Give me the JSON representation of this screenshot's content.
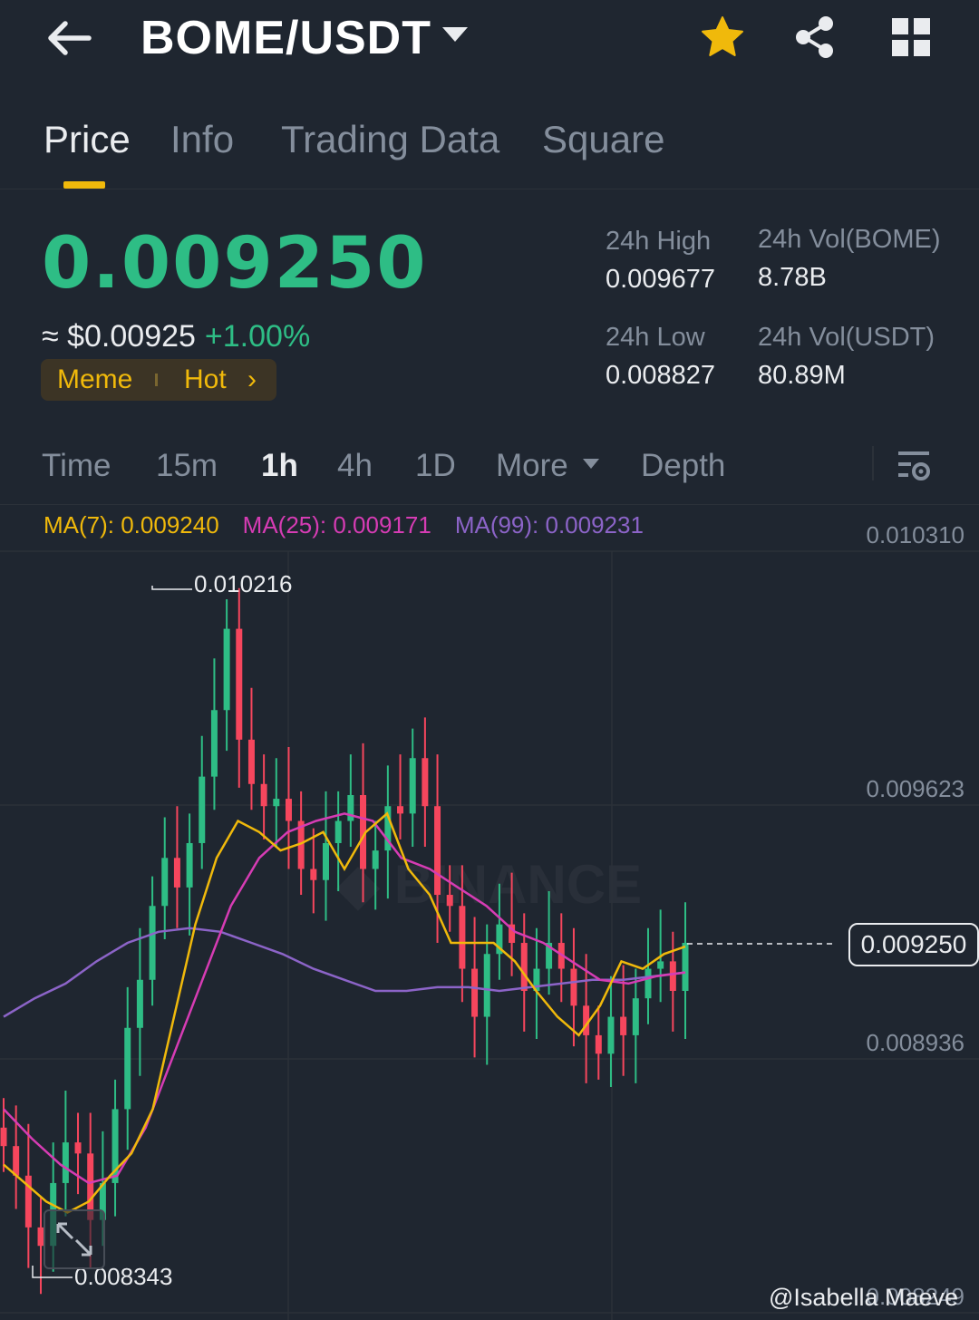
{
  "header": {
    "pair": "BOME/USDT",
    "icons": [
      "back-arrow-icon",
      "caret-down-icon",
      "star-icon",
      "share-icon",
      "grid-icon"
    ],
    "star_color": "#f0b90b"
  },
  "tabs": [
    {
      "label": "Price",
      "active": true
    },
    {
      "label": "Info"
    },
    {
      "label": "Trading Data"
    },
    {
      "label": "Square"
    }
  ],
  "ticker": {
    "last_price": "0.009250",
    "usd_price": "≈ $0.00925",
    "change": "+1.00%",
    "tags": [
      "Meme",
      "Hot"
    ],
    "tag_arrow": "›",
    "high_label": "24h High",
    "high": "0.009677",
    "low_label": "24h Low",
    "low": "0.008827",
    "vol_base_label": "24h Vol(BOME)",
    "vol_base": "8.78B",
    "vol_quote_label": "24h Vol(USDT)",
    "vol_quote": "80.89M",
    "up_color": "#2ebd85",
    "down_color": "#f6465d"
  },
  "intervals": [
    "Time",
    "15m",
    "1h",
    "4h",
    "1D",
    "More",
    "Depth"
  ],
  "active_interval": "1h",
  "ma": {
    "ma7": "MA(7): 0.009240",
    "ma25": "MA(25): 0.009171",
    "ma99": "MA(99): 0.009231",
    "ma7_color": "#f0b90b",
    "ma25_color": "#d63cb4",
    "ma99_color": "#8c64c8"
  },
  "chart_data": {
    "type": "candlestick",
    "y_ticks": [
      "0.010310",
      "0.009623",
      "0.008936",
      "0.008249"
    ],
    "ylim": [
      0.00815,
      0.01031
    ],
    "max_label": "0.010216",
    "min_label": "0.008343",
    "last_price_label": "0.009250",
    "close": [
      0.0087,
      0.00862,
      0.00848,
      0.00843,
      0.0086,
      0.00871,
      0.00868,
      0.0085,
      0.0086,
      0.0088,
      0.00902,
      0.00915,
      0.00935,
      0.00948,
      0.0094,
      0.00952,
      0.0097,
      0.00988,
      0.0101,
      0.0098,
      0.00968,
      0.00962,
      0.00964,
      0.00958,
      0.00945,
      0.00942,
      0.00952,
      0.00958,
      0.00965,
      0.00945,
      0.0095,
      0.00962,
      0.0096,
      0.00975,
      0.00962,
      0.00938,
      0.00935,
      0.00918,
      0.00905,
      0.00922,
      0.0093,
      0.00925,
      0.00912,
      0.00918,
      0.00925,
      0.00918,
      0.00908,
      0.009,
      0.00895,
      0.00905,
      0.009,
      0.0091,
      0.00918,
      0.0092,
      0.00912,
      0.00925
    ],
    "ma7": [
      0.00865,
      0.0086,
      0.00855,
      0.00852,
      0.00855,
      0.00862,
      0.00868,
      0.0088,
      0.00905,
      0.0093,
      0.00948,
      0.00958,
      0.00955,
      0.0095,
      0.00952,
      0.00955,
      0.00945,
      0.00955,
      0.0096,
      0.00945,
      0.00938,
      0.00925,
      0.00925,
      0.00925,
      0.0092,
      0.00912,
      0.00905,
      0.009,
      0.00908,
      0.0092,
      0.00918,
      0.00922,
      0.00924
    ],
    "ma25": [
      0.0088,
      0.00872,
      0.00865,
      0.0086,
      0.00862,
      0.00875,
      0.00895,
      0.00915,
      0.00935,
      0.00948,
      0.00955,
      0.00958,
      0.0096,
      0.00958,
      0.00948,
      0.00945,
      0.0094,
      0.00935,
      0.00928,
      0.00925,
      0.0092,
      0.00915,
      0.00914,
      0.00916,
      0.00917
    ],
    "ma99": [
      0.00905,
      0.0091,
      0.00914,
      0.0092,
      0.00925,
      0.00928,
      0.00929,
      0.00928,
      0.00925,
      0.00922,
      0.00918,
      0.00915,
      0.00912,
      0.00912,
      0.00913,
      0.00913,
      0.00912,
      0.00913,
      0.00914,
      0.00915,
      0.00915,
      0.00916,
      0.00917
    ]
  },
  "expand_icon": "expand-arrows-icon",
  "watermark": "@Isabella Maeve"
}
